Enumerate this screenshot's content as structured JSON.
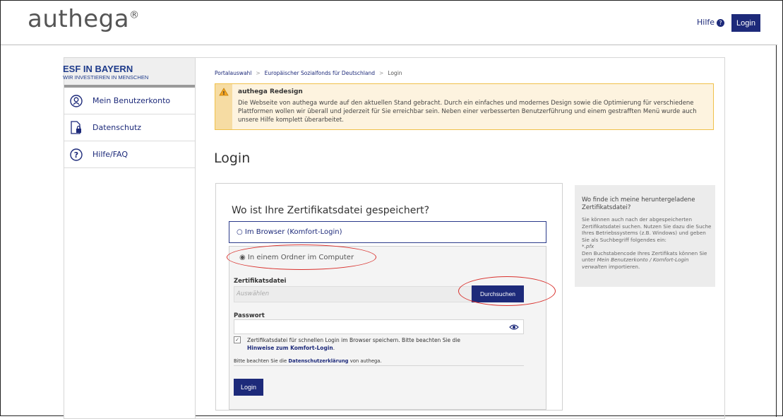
{
  "header": {
    "logo": "authega",
    "logo_mark": "®",
    "help_label": "Hilfe",
    "help_icon": "question-circle-icon",
    "login_label": "Login"
  },
  "sidebar": {
    "brand_title": "ESF IN BAYERN",
    "brand_subtitle": "WIR INVESTIEREN IN MENSCHEN",
    "items": [
      {
        "label": "Mein Benutzerkonto",
        "icon": "user-circle-icon"
      },
      {
        "label": "Datenschutz",
        "icon": "document-lock-icon"
      },
      {
        "label": "Hilfe/FAQ",
        "icon": "question-circle-icon"
      }
    ]
  },
  "breadcrumb": [
    "Portalauswahl",
    "Europäischer Sozialfonds für Deutschland",
    "Login"
  ],
  "notice": {
    "icon": "warning-icon",
    "title": "authega Redesign",
    "text": "Die Webseite von authega wurde auf den aktuellen Stand gebracht. Durch ein einfaches und modernes Design sowie die Optimierung für verschiedene Plattformen wollen wir überall und jederzeit für Sie erreichbar sein. Neben einer verbesserten Benutzerführung und einem gestrafften Menü wurde auch unsere Hilfe komplett überarbeitet."
  },
  "page_title": "Login",
  "form": {
    "question": "Wo ist Ihre Zertifikatsdatei gespeichert?",
    "option_browser": "Im Browser (Komfort-Login)",
    "option_folder": "In einem Ordner im Computer",
    "file_label": "Zertifikatsdatei",
    "file_placeholder": "Auswählen",
    "browse_label": "Durchsuchen",
    "password_label": "Passwort",
    "password_value": "",
    "checkbox_text": "Zertifikatsdatei für schnellen Login im Browser speichern. Bitte beachten Sie die",
    "checkbox_link": "Hinweise zum Komfort-Login",
    "checkbox_end": ".",
    "privacy_prefix": "Bitte beachten Sie die",
    "privacy_link": "Datenschutzerklärung",
    "privacy_suffix": "von authega.",
    "submit_label": "Login"
  },
  "help_panel": {
    "title": "Wo finde ich meine heruntergeladene Zertifikatsdatei?",
    "p1": "Sie können auch nach der abgespeicherten Zertifikatsdatei suchen. Nutzen Sie dazu die Suche Ihres Betriebssystems (z.B. Windows) und geben Sie als Suchbegriff folgendes ein:",
    "ext": "*.pfx",
    "p2a": "Den Buchstabencode Ihres Zertifikats können Sie unter",
    "p2_em": "Mein Benutzerkonto / Komfort-Login verwalten",
    "p2b": "importieren."
  },
  "colors": {
    "brand_blue": "#1d2a7a",
    "notice_border": "#f0c14b",
    "annotation_red": "#d9302c"
  }
}
